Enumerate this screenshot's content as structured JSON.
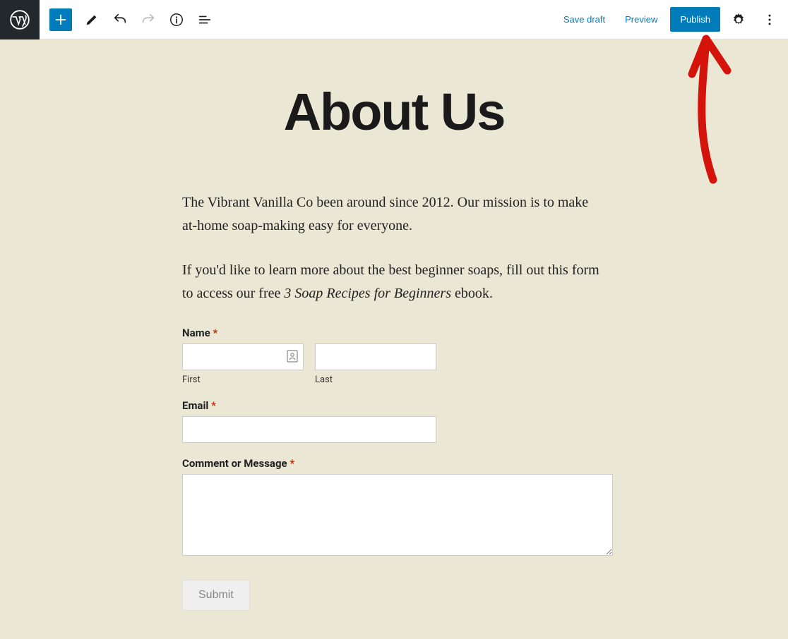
{
  "toolbar": {
    "save_draft": "Save draft",
    "preview": "Preview",
    "publish": "Publish"
  },
  "page": {
    "title": "About Us",
    "para1": "The Vibrant Vanilla Co been around since 2012. Our mission is to make at-home soap-making easy for everyone.",
    "para2_prefix": "If you'd like to learn more about the best beginner soaps, fill out this form to access our free ",
    "para2_italic": "3 Soap Recipes for Beginners",
    "para2_suffix": " ebook."
  },
  "form": {
    "name_label": "Name ",
    "first_sub": "First",
    "last_sub": "Last",
    "email_label": "Email ",
    "message_label": "Comment or Message ",
    "required_mark": "*",
    "submit": "Submit"
  }
}
